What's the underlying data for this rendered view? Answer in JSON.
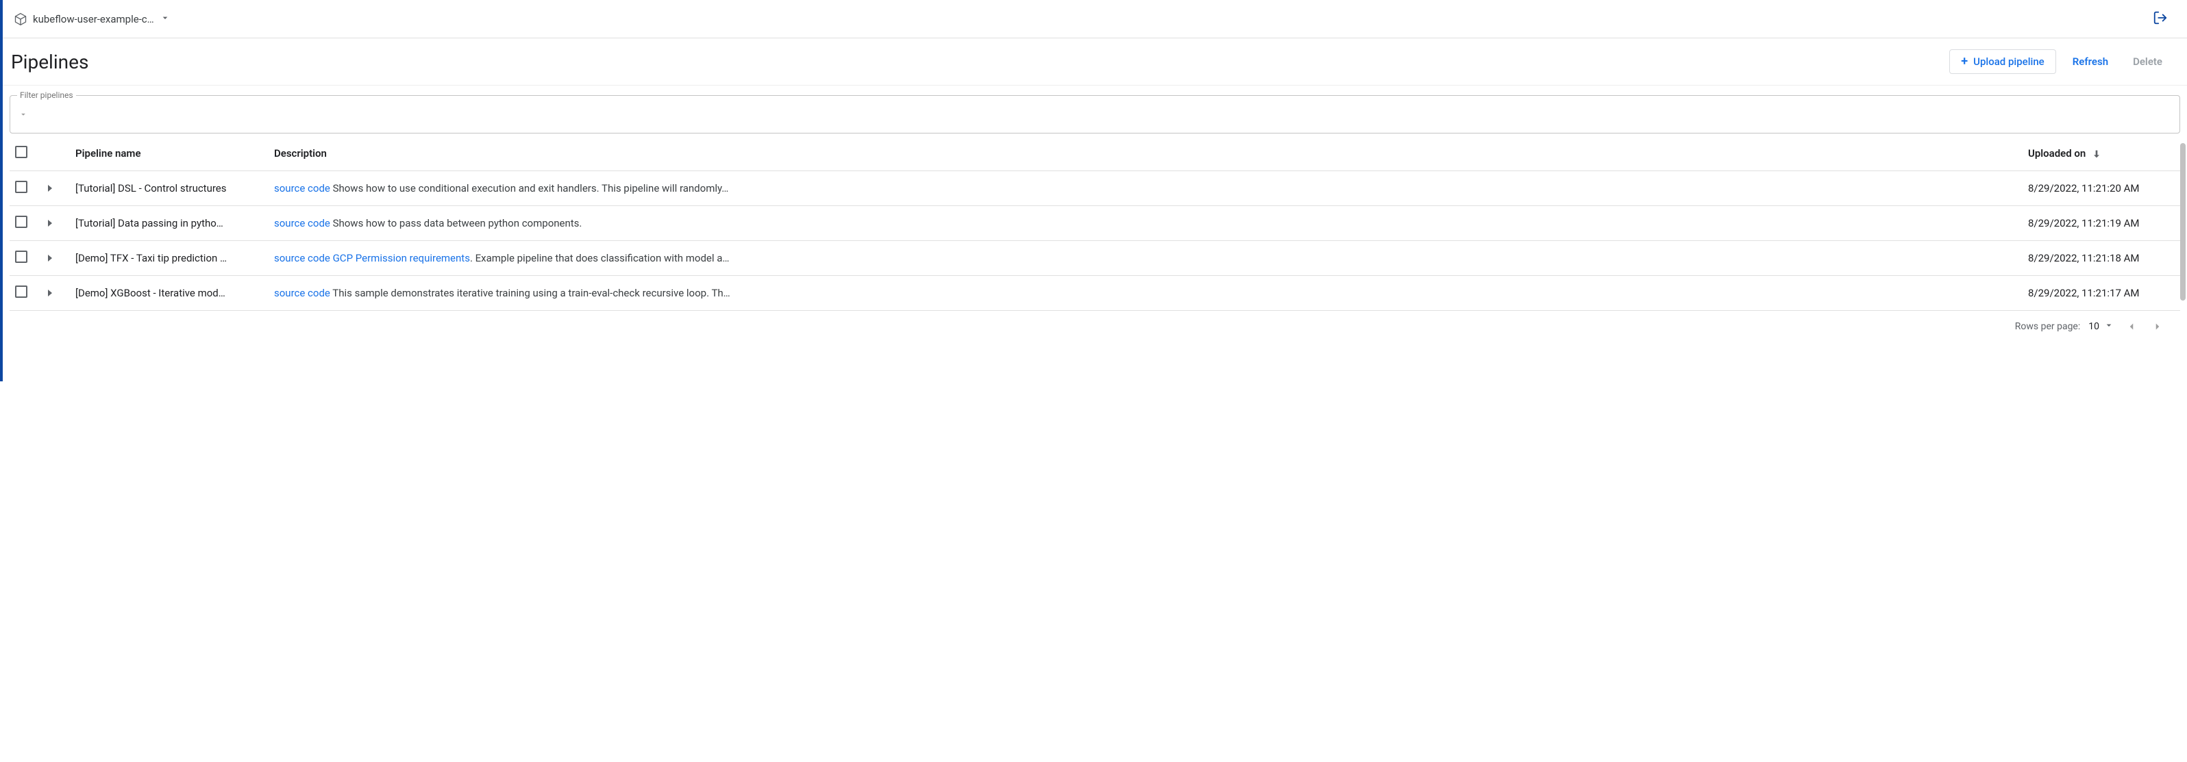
{
  "topbar": {
    "namespace": "kubeflow-user-example-c…"
  },
  "header": {
    "title": "Pipelines",
    "upload_label": "Upload pipeline",
    "refresh_label": "Refresh",
    "delete_label": "Delete"
  },
  "filter": {
    "legend": "Filter pipelines",
    "placeholder": ""
  },
  "table": {
    "columns": {
      "name": "Pipeline name",
      "description": "Description",
      "uploaded": "Uploaded on"
    },
    "rows": [
      {
        "name": "[Tutorial] DSL - Control structures",
        "desc_links": [
          "source code"
        ],
        "desc_text": " Shows how to use conditional execution and exit handlers. This pipeline will randomly…",
        "uploaded": "8/29/2022, 11:21:20 AM"
      },
      {
        "name": "[Tutorial] Data passing in pytho…",
        "desc_links": [
          "source code"
        ],
        "desc_text": " Shows how to pass data between python components.",
        "uploaded": "8/29/2022, 11:21:19 AM"
      },
      {
        "name": "[Demo] TFX - Taxi tip prediction …",
        "desc_links": [
          "source code",
          "GCP Permission requirements"
        ],
        "desc_text": ". Example pipeline that does classification with model a…",
        "uploaded": "8/29/2022, 11:21:18 AM"
      },
      {
        "name": "[Demo] XGBoost - Iterative mod…",
        "desc_links": [
          "source code"
        ],
        "desc_text": " This sample demonstrates iterative training using a train-eval-check recursive loop. Th…",
        "uploaded": "8/29/2022, 11:21:17 AM"
      }
    ]
  },
  "pagination": {
    "rows_label": "Rows per page:",
    "rows_value": "10"
  }
}
